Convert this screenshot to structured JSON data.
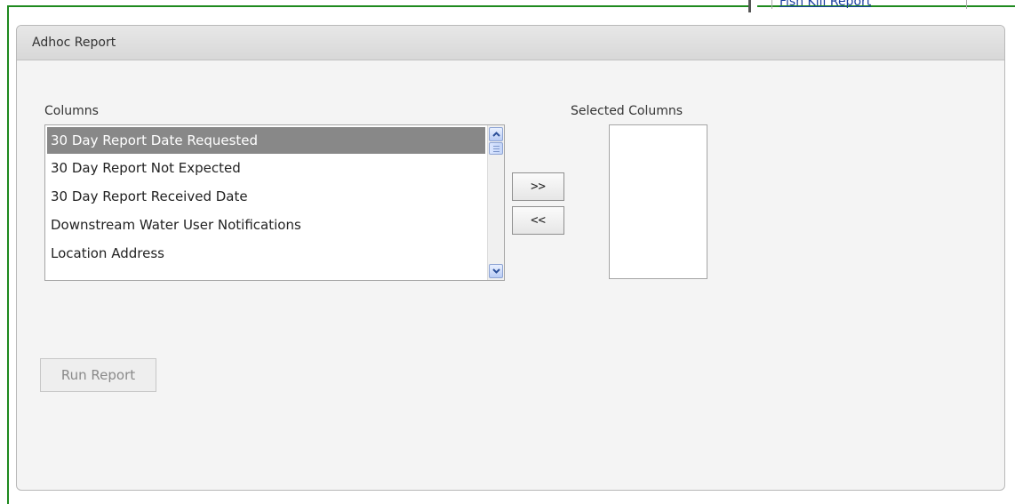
{
  "top_menu": {
    "item_label": "Fish Kill Report"
  },
  "panel": {
    "title": "Adhoc Report"
  },
  "columns": {
    "label": "Columns",
    "items": [
      {
        "label": "30 Day Report Date Requested",
        "selected": true
      },
      {
        "label": "30 Day Report Not Expected",
        "selected": false
      },
      {
        "label": "30 Day Report Received Date",
        "selected": false
      },
      {
        "label": "Downstream Water User Notifications",
        "selected": false
      },
      {
        "label": "Location Address",
        "selected": false
      }
    ]
  },
  "buttons": {
    "add_label": ">>",
    "remove_label": "<<",
    "run_label": "Run Report"
  },
  "selected_columns": {
    "label": "Selected Columns",
    "items": []
  },
  "colors": {
    "frame": "#1f8a1f",
    "selected_row": "#888888",
    "scroll_blue": "#b9ccf5"
  }
}
